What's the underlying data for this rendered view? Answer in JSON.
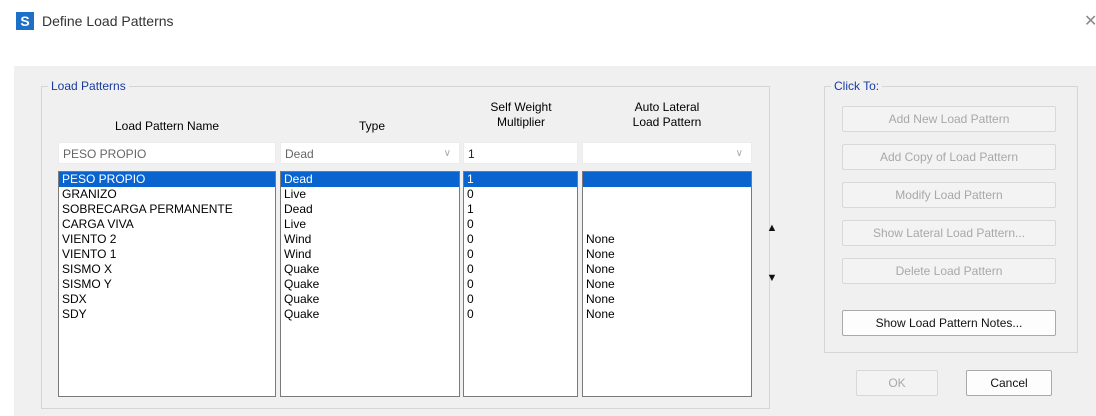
{
  "window": {
    "title": "Define Load Patterns",
    "app_icon_letter": "S",
    "close_glyph": "✕"
  },
  "load_patterns": {
    "group_title": "Load Patterns",
    "headers": {
      "name": "Load Pattern Name",
      "type": "Type",
      "self_weight": [
        "Self Weight",
        "Multiplier"
      ],
      "auto_lateral": [
        "Auto Lateral",
        "Load Pattern"
      ]
    },
    "edit_row": {
      "name": "PESO PROPIO",
      "type": "Dead",
      "multiplier": "1",
      "auto_lateral": ""
    },
    "selected_index": 0,
    "rows": [
      {
        "name": "PESO PROPIO",
        "type": "Dead",
        "multiplier": "1",
        "auto_lateral": ""
      },
      {
        "name": "GRANIZO",
        "type": "Live",
        "multiplier": "0",
        "auto_lateral": ""
      },
      {
        "name": "SOBRECARGA PERMANENTE",
        "type": "Dead",
        "multiplier": "1",
        "auto_lateral": ""
      },
      {
        "name": "CARGA VIVA",
        "type": "Live",
        "multiplier": "0",
        "auto_lateral": ""
      },
      {
        "name": "VIENTO 2",
        "type": "Wind",
        "multiplier": "0",
        "auto_lateral": "None"
      },
      {
        "name": "VIENTO 1",
        "type": "Wind",
        "multiplier": "0",
        "auto_lateral": "None"
      },
      {
        "name": "SISMO X",
        "type": "Quake",
        "multiplier": "0",
        "auto_lateral": "None"
      },
      {
        "name": "SISMO Y",
        "type": "Quake",
        "multiplier": "0",
        "auto_lateral": "None"
      },
      {
        "name": "SDX",
        "type": "Quake",
        "multiplier": "0",
        "auto_lateral": "None"
      },
      {
        "name": "SDY",
        "type": "Quake",
        "multiplier": "0",
        "auto_lateral": "None"
      }
    ]
  },
  "click_to": {
    "group_title": "Click To:",
    "buttons": [
      {
        "label": "Add New Load Pattern",
        "enabled": false
      },
      {
        "label": "Add Copy of Load Pattern",
        "enabled": false
      },
      {
        "label": "Modify Load Pattern",
        "enabled": false
      },
      {
        "label": "Show Lateral Load Pattern...",
        "enabled": false
      },
      {
        "label": "Delete Load Pattern",
        "enabled": false
      },
      {
        "label": "Show Load Pattern Notes...",
        "enabled": true
      }
    ]
  },
  "footer": {
    "ok_label": "OK",
    "ok_enabled": false,
    "cancel_label": "Cancel"
  },
  "icons": {
    "move_up": "arrow-up-icon",
    "move_down": "arrow-down-icon",
    "dropdown": "chevron-down-icon"
  },
  "colors": {
    "selection": "#0a64d0",
    "group_title": "#1a3aa0",
    "app_icon": "#1e6fc7"
  }
}
